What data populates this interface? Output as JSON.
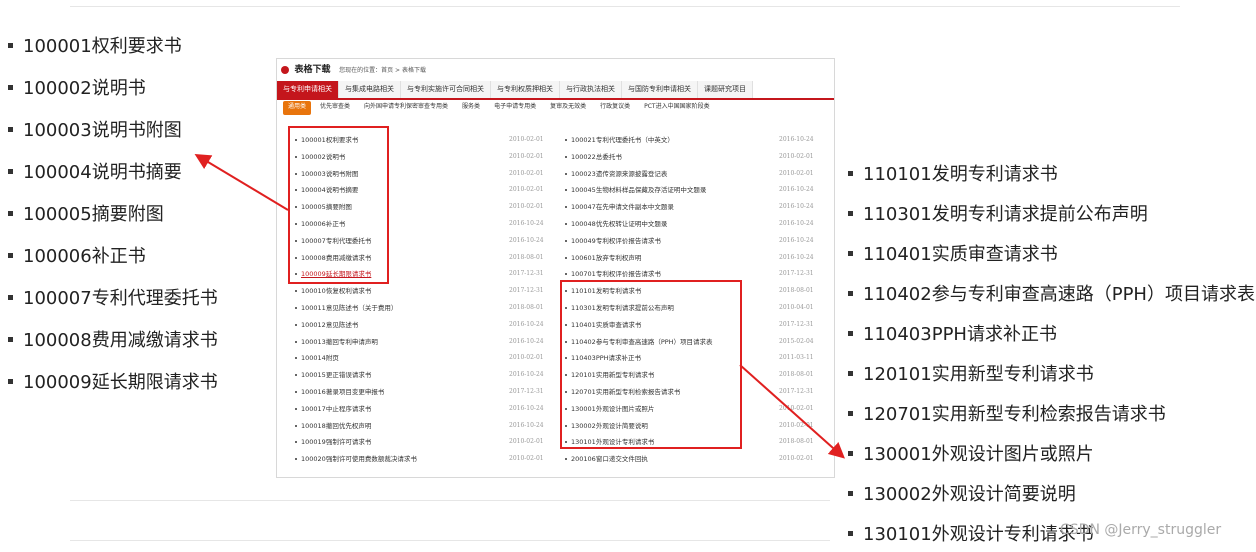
{
  "left_list": [
    "100001权利要求书",
    "100002说明书",
    "100003说明书附图",
    "100004说明书摘要",
    "100005摘要附图",
    "100006补正书",
    "100007专利代理委托书",
    "100008费用减缴请求书",
    "100009延长期限请求书"
  ],
  "right_list": [
    "110101发明专利请求书",
    "110301发明专利请求提前公布声明",
    "110401实质审查请求书",
    "110402参与专利审查高速路（PPH）项目请求表",
    "110403PPH请求补正书",
    "120101实用新型专利请求书",
    "120701实用新型专利检索报告请求书",
    "130001外观设计图片或照片",
    "130002外观设计简要说明",
    "130101外观设计专利请求书"
  ],
  "panel": {
    "title": "表格下载",
    "breadcrumb": "您现在的位置：首页 > 表格下载",
    "tabs": [
      "与专利申请相关",
      "与集成电路相关",
      "与专利实施许可合同相关",
      "与专利权质押相关",
      "与行政执法相关",
      "与国防专利申请相关",
      "课题研究项目"
    ],
    "active_tab": 0,
    "subtabs": [
      "通用类",
      "优先审查类",
      "向外国申请专利保密审查专用类",
      "服务类",
      "电子申请专用类",
      "复审及无效类",
      "行政复议类",
      "PCT进入中国国家阶段类"
    ],
    "active_subtab": 0,
    "col1": [
      {
        "name": "100001权利要求书",
        "date": "2010-02-01"
      },
      {
        "name": "100002说明书",
        "date": "2010-02-01"
      },
      {
        "name": "100003说明书附图",
        "date": "2010-02-01"
      },
      {
        "name": "100004说明书摘要",
        "date": "2010-02-01"
      },
      {
        "name": "100005摘要附图",
        "date": "2010-02-01"
      },
      {
        "name": "100006补正书",
        "date": "2016-10-24"
      },
      {
        "name": "100007专利代理委托书",
        "date": "2016-10-24"
      },
      {
        "name": "100008费用减缴请求书",
        "date": "2018-08-01"
      },
      {
        "name": "100009延长期限请求书",
        "date": "2017-12-31"
      },
      {
        "name": "100010恢复权利请求书",
        "date": "2017-12-31"
      },
      {
        "name": "100011意见陈述书（关于费用）",
        "date": "2018-08-01"
      },
      {
        "name": "100012意见陈述书",
        "date": "2016-10-24"
      },
      {
        "name": "100013撤回专利申请声明",
        "date": "2016-10-24"
      },
      {
        "name": "100014附页",
        "date": "2010-02-01"
      },
      {
        "name": "100015更正错误请求书",
        "date": "2016-10-24"
      },
      {
        "name": "100016著录项目变更申报书",
        "date": "2017-12-31"
      },
      {
        "name": "100017中止程序请求书",
        "date": "2016-10-24"
      },
      {
        "name": "100018撤回优先权声明",
        "date": "2016-10-24"
      },
      {
        "name": "100019强制许可请求书",
        "date": "2010-02-01"
      },
      {
        "name": "100020强制许可使用费数额裁决请求书",
        "date": "2010-02-01"
      }
    ],
    "col2": [
      {
        "name": "100021专利代理委托书（中英文）",
        "date": "2016-10-24"
      },
      {
        "name": "100022总委托书",
        "date": "2010-02-01"
      },
      {
        "name": "100023遗传资源来源披露登记表",
        "date": "2010-02-01"
      },
      {
        "name": "100045生物材料样品保藏及存活证明中文题录",
        "date": "2016-10-24"
      },
      {
        "name": "100047在先申请文件副本中文题录",
        "date": "2016-10-24"
      },
      {
        "name": "100048优先权转让证明中文题录",
        "date": "2016-10-24"
      },
      {
        "name": "100049专利权评价报告请求书",
        "date": "2016-10-24"
      },
      {
        "name": "100601放弃专利权声明",
        "date": "2016-10-24"
      },
      {
        "name": "100701专利权评价报告请求书",
        "date": "2017-12-31"
      },
      {
        "name": "110101发明专利请求书",
        "date": "2018-08-01"
      },
      {
        "name": "110301发明专利请求提前公布声明",
        "date": "2010-04-01"
      },
      {
        "name": "110401实质审查请求书",
        "date": "2017-12-31"
      },
      {
        "name": "110402参与专利审查高速路（PPH）项目请求表",
        "date": "2015-02-04"
      },
      {
        "name": "110403PPH请求补正书",
        "date": "2011-03-11"
      },
      {
        "name": "120101实用新型专利请求书",
        "date": "2018-08-01"
      },
      {
        "name": "120701实用新型专利检索报告请求书",
        "date": "2017-12-31"
      },
      {
        "name": "130001外观设计图片或照片",
        "date": "2010-02-01"
      },
      {
        "name": "130002外观设计简要说明",
        "date": "2010-02-01"
      },
      {
        "name": "130101外观设计专利请求书",
        "date": "2018-08-01"
      },
      {
        "name": "200106窗口递交文件回执",
        "date": "2010-02-01"
      }
    ]
  },
  "watermark": "CSDN @Jerry_struggler",
  "colors": {
    "accent": "#c4161c",
    "subtab_active": "#e8740c",
    "annotation": "#e02020"
  }
}
